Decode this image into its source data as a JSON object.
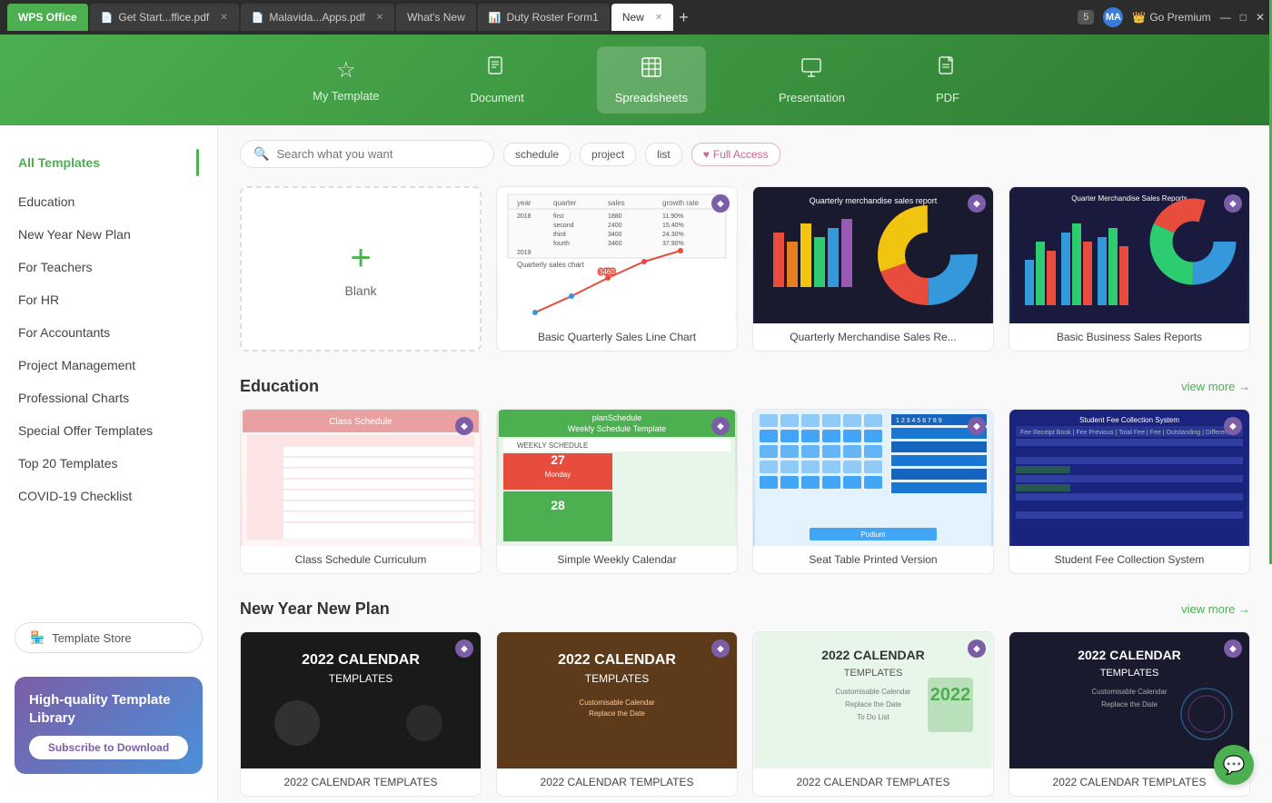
{
  "tabs": [
    {
      "label": "WPS Office",
      "type": "wps",
      "active": false
    },
    {
      "label": "Get Start...ffice.pdf",
      "type": "pdf-red",
      "active": false,
      "closable": true
    },
    {
      "label": "Malavida...Apps.pdf",
      "type": "pdf-red",
      "active": false,
      "closable": true
    },
    {
      "label": "What's New",
      "type": "normal",
      "active": false,
      "closable": false
    },
    {
      "label": "Duty Roster Form1",
      "type": "sheet-green",
      "active": false,
      "closable": false
    },
    {
      "label": "New",
      "type": "normal",
      "active": true,
      "closable": true
    }
  ],
  "tab_num": "5",
  "avatar_initials": "MA",
  "go_premium_label": "Go Premium",
  "win_controls": [
    "—",
    "□",
    "✕"
  ],
  "nav": {
    "items": [
      {
        "id": "my-template",
        "label": "My Template",
        "icon": "☆"
      },
      {
        "id": "document",
        "label": "Document",
        "icon": "📄"
      },
      {
        "id": "spreadsheets",
        "label": "Spreadsheets",
        "icon": "📊",
        "active": true
      },
      {
        "id": "presentation",
        "label": "Presentation",
        "icon": "🖼"
      },
      {
        "id": "pdf",
        "label": "PDF",
        "icon": "📋"
      }
    ]
  },
  "sidebar": {
    "items": [
      {
        "label": "All Templates",
        "active": true
      },
      {
        "label": "Education"
      },
      {
        "label": "New Year New Plan"
      },
      {
        "label": "For Teachers"
      },
      {
        "label": "For HR"
      },
      {
        "label": "For Accountants"
      },
      {
        "label": "Project Management"
      },
      {
        "label": "Professional Charts"
      },
      {
        "label": "Special Offer Templates"
      },
      {
        "label": "Top 20 Templates"
      },
      {
        "label": "COVID-19 Checklist"
      }
    ],
    "template_store_label": "Template Store",
    "promo": {
      "title": "High-quality Template Library",
      "subscribe_label": "Subscribe to Download"
    }
  },
  "search": {
    "placeholder": "Search what you want",
    "tags": [
      "schedule",
      "project",
      "list"
    ],
    "full_access_label": "Full Access"
  },
  "blank": {
    "label": "Blank"
  },
  "sections": {
    "featured": {
      "templates": [
        {
          "label": "Basic Quarterly Sales Line Chart",
          "type": "sales-line"
        },
        {
          "label": "Quarterly Merchandise Sales Re...",
          "type": "merch"
        },
        {
          "label": "Basic Business Sales Reports",
          "type": "biz"
        }
      ]
    },
    "education": {
      "title": "Education",
      "view_more": "view more →",
      "templates": [
        {
          "label": "Class Schedule Curriculum",
          "type": "class"
        },
        {
          "label": "Simple Weekly Calendar",
          "type": "weekly"
        },
        {
          "label": "Seat Table Printed Version",
          "type": "seat"
        },
        {
          "label": "Student Fee Collection System",
          "type": "student"
        }
      ]
    },
    "new_year": {
      "title": "New Year New Plan",
      "view_more": "view more →",
      "templates": [
        {
          "label": "2022 CALENDAR TEMPLATES",
          "type": "cal1"
        },
        {
          "label": "2022 CALENDAR TEMPLATES",
          "type": "cal2"
        },
        {
          "label": "2022 CALENDAR TEMPLATES",
          "type": "cal3"
        },
        {
          "label": "2022 CALENDAR TEMPLATES",
          "type": "cal4"
        }
      ]
    }
  }
}
